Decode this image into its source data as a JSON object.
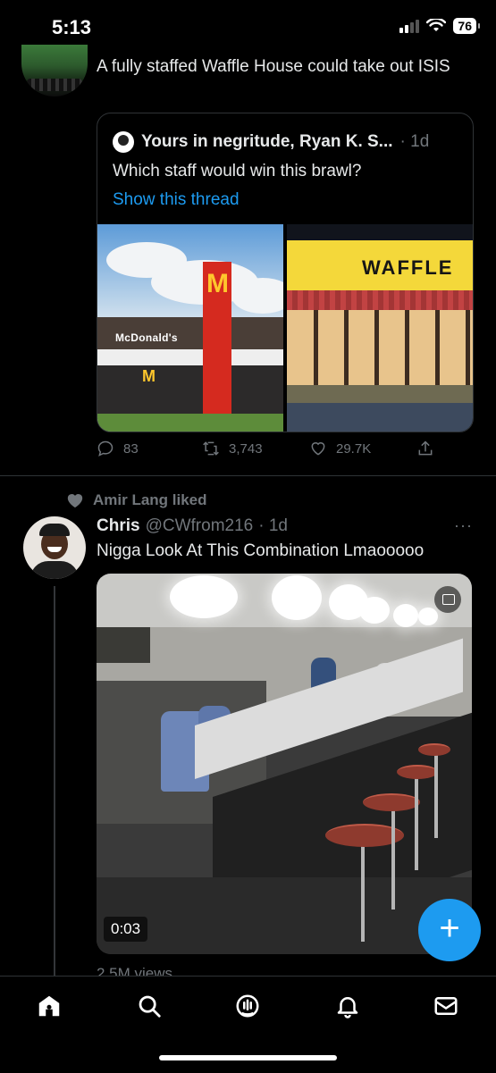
{
  "status_bar": {
    "time": "5:13",
    "battery": "76"
  },
  "tweet1": {
    "text": "A fully staffed Waffle House could take out ISIS",
    "quote": {
      "author": "Yours in negritude, Ryan K. S...",
      "meta": "· 1d",
      "text": "Which staff would win this brawl?",
      "link": "Show this thread",
      "image1": {
        "sign": "McDonald's",
        "logo": "M"
      },
      "image2": {
        "sign": "WAFFLE"
      }
    },
    "actions": {
      "replies": "83",
      "retweets": "3,743",
      "likes": "29.7K"
    }
  },
  "tweet2": {
    "social_context": "Amir Lang liked",
    "name": "Chris",
    "handle": "@CWfrom216",
    "meta": "· 1d",
    "more": "···",
    "text": "Nigga Look At This Combination Lmaooooo",
    "video_duration": "0:03",
    "views": "2.5M views"
  },
  "fab": {
    "label": "+"
  },
  "nav": [
    "home-icon",
    "search-icon",
    "spaces-icon",
    "notifications-icon",
    "messages-icon"
  ],
  "colors": {
    "accent": "#1d9bf0",
    "background": "#000000",
    "muted": "#71767b"
  }
}
